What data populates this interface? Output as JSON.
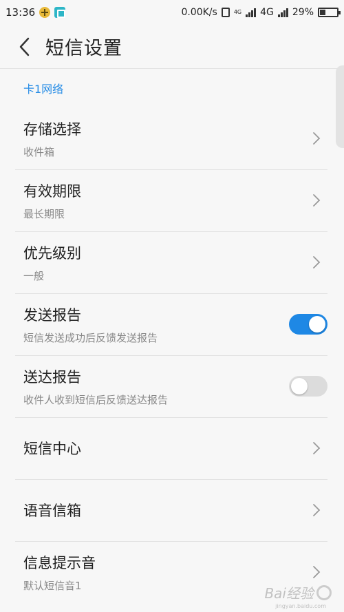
{
  "status_bar": {
    "time": "13:36",
    "net_speed": "0.00K/s",
    "network_tag": "4G",
    "network_type": "4G",
    "battery": "29%",
    "battery_level": 0.29
  },
  "header": {
    "title": "短信设置"
  },
  "section": {
    "title": "卡1网络"
  },
  "rows": [
    {
      "label": "存储选择",
      "sub": "收件箱"
    },
    {
      "label": "有效期限",
      "sub": "最长期限"
    },
    {
      "label": "优先级别",
      "sub": "一般"
    },
    {
      "label": "发送报告",
      "sub": "短信发送成功后反馈发送报告",
      "toggle": "on"
    },
    {
      "label": "送达报告",
      "sub": "收件人收到短信后反馈送达报告",
      "toggle": "off"
    },
    {
      "label": "短信中心"
    },
    {
      "label": "语音信箱"
    },
    {
      "label": "信息提示音",
      "sub": "默认短信音1"
    }
  ],
  "watermark": {
    "text": "Bai经验",
    "sub": "jingyan.baidu.com"
  },
  "colors": {
    "accent": "#2a8ee6",
    "toggle_on": "#1e88e5",
    "toggle_off": "#dcdcdc"
  }
}
